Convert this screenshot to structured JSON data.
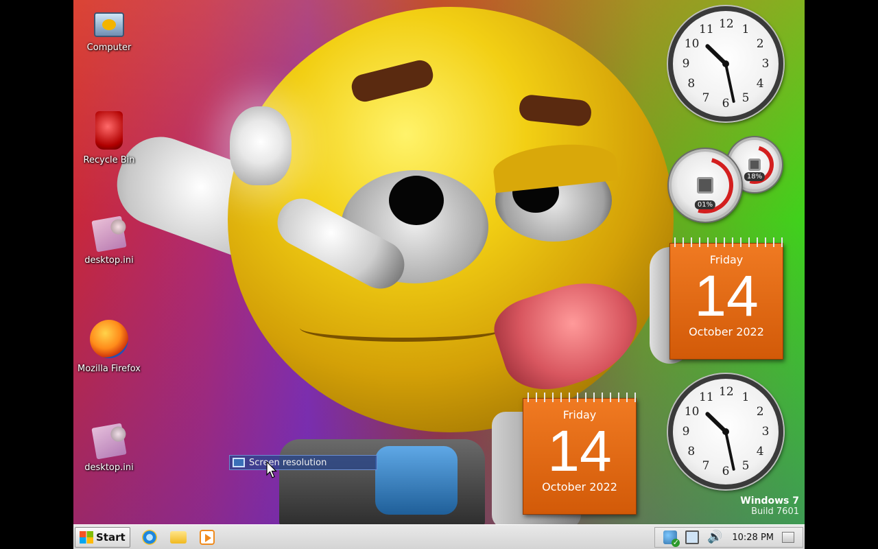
{
  "desktop": {
    "icons": [
      {
        "label": "Computer",
        "icon": "computer-icon"
      },
      {
        "label": "Recycle Bin",
        "icon": "recycle-bin-icon"
      },
      {
        "label": "desktop.ini",
        "icon": "ini-file-icon"
      },
      {
        "label": "Mozilla Firefox",
        "icon": "firefox-icon"
      },
      {
        "label": "desktop.ini",
        "icon": "ini-file-icon"
      }
    ],
    "context_item": {
      "label": "Screen resolution",
      "icon": "monitor-icon"
    },
    "watermark": {
      "line1": "Windows 7",
      "line2": "Build 7601"
    }
  },
  "gadgets": {
    "clock_top": {
      "hours": [
        12,
        1,
        2,
        3,
        4,
        5,
        6,
        7,
        8,
        9,
        10,
        11
      ],
      "time": "10:28"
    },
    "meter": {
      "cpu_value": "01%",
      "memory_value": "18%"
    },
    "calendar_right": {
      "day": "Friday",
      "date": "14",
      "month": "October 2022"
    },
    "calendar_bottom": {
      "day": "Friday",
      "date": "14",
      "month": "October 2022"
    },
    "clock_bottom": {
      "hours": [
        12,
        1,
        2,
        3,
        4,
        5,
        6,
        7,
        8,
        9,
        10,
        11
      ],
      "time": "10:28"
    }
  },
  "taskbar": {
    "start_label": "Start",
    "quick_launch": [
      "internet-explorer-icon",
      "folder-icon",
      "media-player-icon"
    ],
    "tray_icons": [
      "action-center-icon",
      "network-icon",
      "volume-icon",
      "show-desktop-icon"
    ],
    "clock": "10:28 PM"
  },
  "colors": {
    "calendar_orange": "#e36a14",
    "taskbar_bg": "#dcdcdc"
  }
}
